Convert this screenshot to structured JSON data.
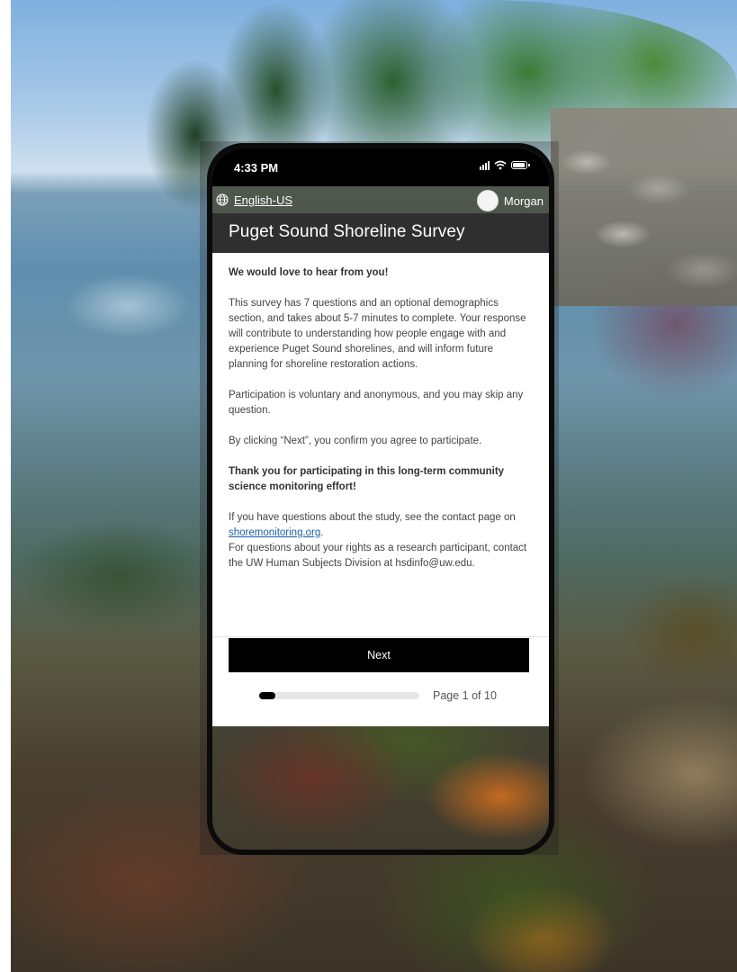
{
  "status_bar": {
    "time": "4:33 PM"
  },
  "lang_bar": {
    "language": "English-US",
    "user_name": "Morgan"
  },
  "survey": {
    "title": "Puget Sound Shoreline Survey",
    "intro_heading": "We would love to hear from you!",
    "paragraph_1": "This survey has 7 questions and an optional demographics section, and takes about 5-7 minutes to complete. Your response will contribute to understanding how people engage with and experience Puget Sound shorelines, and will inform future planning for shoreline restoration actions.",
    "paragraph_2": "Participation is voluntary and anonymous, and you may skip any question.",
    "paragraph_3": "By clicking “Next”, you confirm you agree to participate.",
    "thanks": "Thank you for participating in this long-term community science monitoring effort!",
    "contact_prefix": "If you have questions about the study, see the contact page on ",
    "contact_link": "shoremonitoring.org",
    "contact_suffix": ".",
    "rights_text": "For questions about your rights as a research participant, contact the UW Human Subjects Division at hsdinfo@uw.edu."
  },
  "footer": {
    "next_label": "Next",
    "page_label": "Page 1 of 10",
    "progress_fraction": 0.1
  }
}
